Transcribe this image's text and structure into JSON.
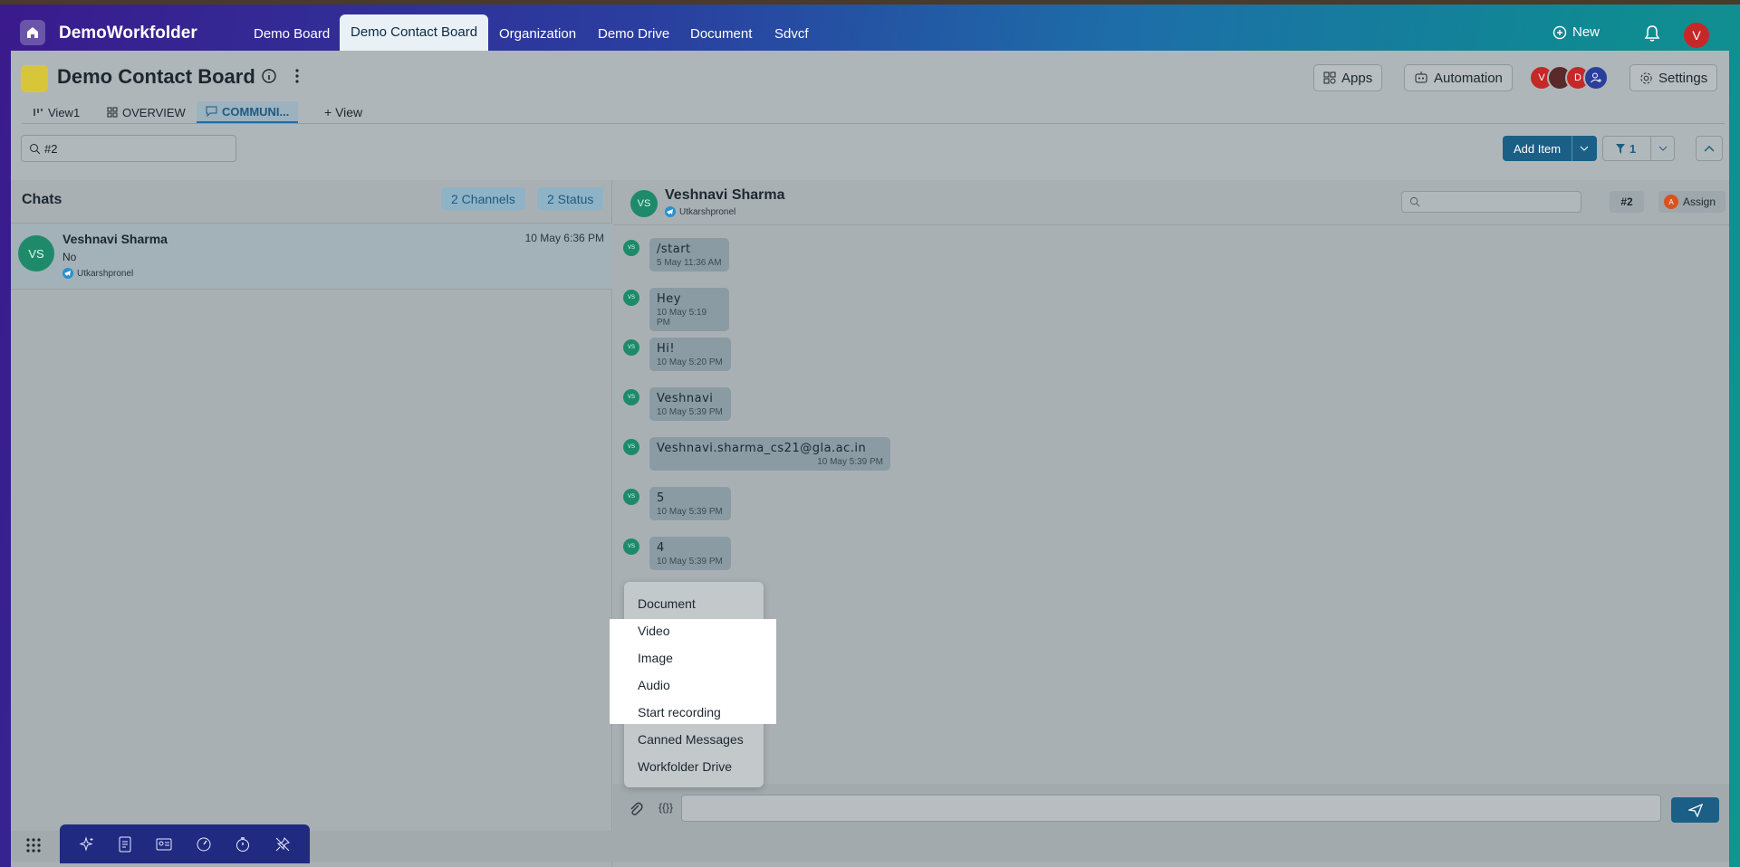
{
  "workspace": "DemoWorkfolder",
  "nav_tabs": [
    "Demo Board",
    "Demo Contact Board",
    "Organization",
    "Demo Drive",
    "Document",
    "Sdvcf"
  ],
  "active_nav": "Demo Contact Board",
  "new_label": "New",
  "user_avatar": "V",
  "board": {
    "title": "Demo Contact Board",
    "apps_label": "Apps",
    "automation_label": "Automation",
    "settings_label": "Settings",
    "members": [
      {
        "initial": "V",
        "color": "#c62828"
      },
      {
        "initial": "",
        "color": "#5a2a2a"
      },
      {
        "initial": "D",
        "color": "#c62828"
      },
      {
        "initial": "+",
        "color": "#2a3f9a"
      }
    ]
  },
  "views": {
    "tabs": [
      {
        "label": "View1",
        "icon": "kanban-icon"
      },
      {
        "label": "OVERVIEW",
        "icon": "grid-icon"
      },
      {
        "label": "COMMUNI...",
        "icon": "chat-icon"
      }
    ],
    "add_view_label": "+ View"
  },
  "toolbar": {
    "search_value": "#2",
    "add_item_label": "Add Item",
    "filter_count": "1"
  },
  "chats": {
    "title": "Chats",
    "channels_label": "2 Channels",
    "status_label": "2 Status",
    "list": [
      {
        "initials": "VS",
        "name": "Veshnavi Sharma",
        "preview": "No",
        "time": "10 May 6:36 PM",
        "handle": "Utkarshpronel"
      }
    ]
  },
  "conversation": {
    "name": "Veshnavi Sharma",
    "handle": "Utkarshpronel",
    "initials": "VS",
    "tag": "#2",
    "assign_label": "Assign",
    "assign_initial": "A",
    "messages": [
      {
        "text": "/start",
        "time": "5 May 11:36 AM"
      },
      {
        "text": "Hey",
        "time": "10 May 5:19 PM"
      },
      {
        "text": "Hi!",
        "time": "10 May 5:20 PM"
      },
      {
        "text": "Veshnavi",
        "time": "10 May 5:39 PM"
      },
      {
        "text": "Veshnavi.sharma_cs21@gla.ac.in",
        "time": "10 May 5:39 PM"
      },
      {
        "text": "5",
        "time": "10 May 5:39 PM"
      },
      {
        "text": "4",
        "time": "10 May 5:39 PM"
      }
    ]
  },
  "attach_menu": [
    "Document",
    "Video",
    "Image",
    "Audio",
    "Start recording",
    "Canned Messages",
    "Workfolder Drive"
  ],
  "composer": {
    "vars_label": "{{}}"
  }
}
